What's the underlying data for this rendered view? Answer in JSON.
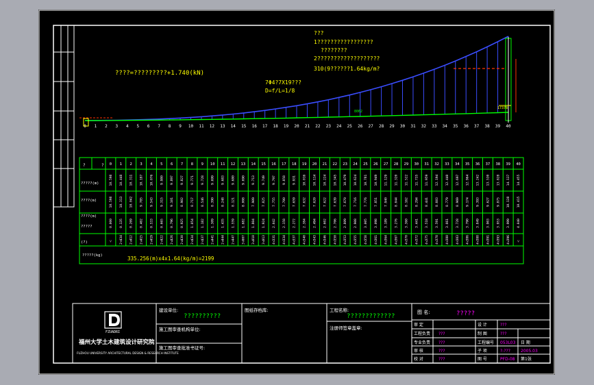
{
  "title_block": {
    "logo_text": "FZUADRI",
    "institute_cn": "福州大学土木建筑设计研究院",
    "institute_en": "FUZHOU UNIVERSITY ARCHITECTURAL DESIGN & RESEARCH INSTITUTE",
    "construction_unit_label": "建设单位:",
    "construction_unit_value": "??????????",
    "drawing_review_org_label": "施工图审查机构单位:",
    "drawing_review_cert_label": "施工图审查批准书证号:",
    "drawing_archive_label": "图纸存档库:",
    "project_name_label": "工程名称:",
    "project_name_value": "?????????????",
    "registered_engineer_label": "注册师签章盖章:",
    "drawing_name_label": "图  名:",
    "drawing_name_value": "?????",
    "rows": [
      {
        "l1": "审 定",
        "v1": "",
        "l2": "设 计",
        "v2": "???"
      },
      {
        "l1": "工程负责",
        "v1": "???",
        "l2": "制 图",
        "v2": "???"
      },
      {
        "l1": "专业负责",
        "v1": "???",
        "l2": "工程编号",
        "v2": "053L03",
        "l3": "日 期",
        "v3": ""
      },
      {
        "l1": "审 核",
        "v1": "???",
        "l2": "子 项",
        "v2": "?-???",
        "l3": "",
        "v3": "2005.03"
      },
      {
        "l1": "校 对",
        "v1": "???",
        "l2": "图 号",
        "v2": "PFD-08",
        "l3": "第1张",
        "v3": ""
      }
    ]
  },
  "diagram": {
    "note_lines": [
      "???",
      "1?????????????????",
      "????????",
      "2???????????????????",
      "310(9??????1.64kg/m?"
    ],
    "load_label": "????=?????????+1.740(kN)",
    "cable_label_1": "7Φ4?7X19???",
    "cable_label_2": "D=f/L=1/8",
    "mid_dim": "8062",
    "right_dim": "17378",
    "node_numbers": [
      "0",
      "1",
      "2",
      "3",
      "4",
      "5",
      "6",
      "7",
      "8",
      "9",
      "10",
      "11",
      "12",
      "13",
      "14",
      "15",
      "16",
      "17",
      "18",
      "19",
      "20",
      "21",
      "22",
      "23",
      "24",
      "25",
      "26",
      "27",
      "28",
      "29",
      "30",
      "31",
      "32",
      "33",
      "34",
      "35",
      "36",
      "37",
      "38",
      "39",
      "40"
    ]
  },
  "table": {
    "corner": "?",
    "corner2": "?",
    "columns": [
      "0",
      "1",
      "2",
      "3",
      "4",
      "5",
      "6",
      "7",
      "8",
      "9",
      "10",
      "11",
      "12",
      "13",
      "14",
      "15",
      "16",
      "17",
      "18",
      "19",
      "20",
      "21",
      "22",
      "23",
      "24",
      "25",
      "26",
      "27",
      "28",
      "29",
      "30",
      "31",
      "32",
      "33",
      "34",
      "35",
      "36",
      "37",
      "38",
      "39",
      "40"
    ],
    "row_labels": [
      "?????(m)",
      "????(m)",
      "????(m)",
      "?????",
      "(?)"
    ],
    "row1": [
      "10.598",
      "10.448",
      "10.311",
      "10.187",
      "10.076",
      "9.980",
      "9.897",
      "9.827",
      "9.771",
      "9.728",
      "9.699",
      "9.683",
      "9.680",
      "9.690",
      "9.713",
      "9.749",
      "9.797",
      "9.858",
      "9.931",
      "10.016",
      "10.114",
      "10.224",
      "10.345",
      "10.479",
      "10.624",
      "10.781",
      "10.949",
      "11.129",
      "11.320",
      "11.522",
      "11.735",
      "11.959",
      "12.194",
      "12.440",
      "12.697",
      "12.964",
      "13.242",
      "13.530",
      "13.828",
      "14.137",
      "14.455"
    ],
    "row2": [
      "10.598",
      "10.313",
      "10.042",
      "9.785",
      "9.543",
      "9.315",
      "9.101",
      "8.902",
      "8.717",
      "8.546",
      "8.390",
      "8.248",
      "8.121",
      "8.008",
      "7.909",
      "7.825",
      "7.755",
      "7.700",
      "7.659",
      "7.632",
      "7.620",
      "7.622",
      "7.639",
      "7.670",
      "7.716",
      "7.776",
      "7.851",
      "7.940",
      "8.044",
      "8.162",
      "8.294",
      "8.441",
      "8.603",
      "8.779",
      "8.969",
      "9.174",
      "9.393",
      "9.627",
      "9.875",
      "10.138",
      "10.415"
    ],
    "row3": [
      "0.000",
      "0.135",
      "0.269",
      "0.402",
      "0.533",
      "0.665",
      "0.796",
      "0.925",
      "1.054",
      "1.182",
      "1.309",
      "1.435",
      "1.559",
      "1.682",
      "1.804",
      "1.924",
      "2.042",
      "2.158",
      "2.272",
      "2.384",
      "2.494",
      "2.602",
      "2.706",
      "2.809",
      "2.908",
      "3.005",
      "3.098",
      "3.189",
      "3.276",
      "3.360",
      "3.441",
      "3.518",
      "3.591",
      "3.661",
      "3.728",
      "3.790",
      "3.849",
      "3.903",
      "3.953",
      "3.999",
      "4.040"
    ],
    "row4": [
      "",
      "2.434",
      "2.412",
      "2.415",
      "2.419",
      "2.422",
      "2.426",
      "2.430",
      "2.434",
      "2.437",
      "2.441",
      "2.444",
      "2.447",
      "3.007",
      "3.010",
      "3.013",
      "4.331",
      "4.334",
      "4.337",
      "4.340",
      "4.343",
      "4.346",
      "4.350",
      "4.353",
      "4.355",
      "4.358",
      "4.361",
      "4.364",
      "4.367",
      "4.370",
      "4.372",
      "4.375",
      "4.378",
      "4.380",
      "4.383",
      "4.386",
      "4.388",
      "4.391",
      "4.393",
      "4.396",
      ""
    ],
    "row5_mark": "˅",
    "total_label": "?????(kg)",
    "total_value": "335.256(m)x4x1.64(kg/m)=2199"
  },
  "colors": {
    "background": "#000000",
    "border": "#ffffff",
    "table_lines": "#00ff00",
    "cable": "#3a4dff",
    "load_text": "#ffff00",
    "accent": "#ff3300",
    "magenta": "#ff00ff",
    "cyan": "#00ffff"
  }
}
